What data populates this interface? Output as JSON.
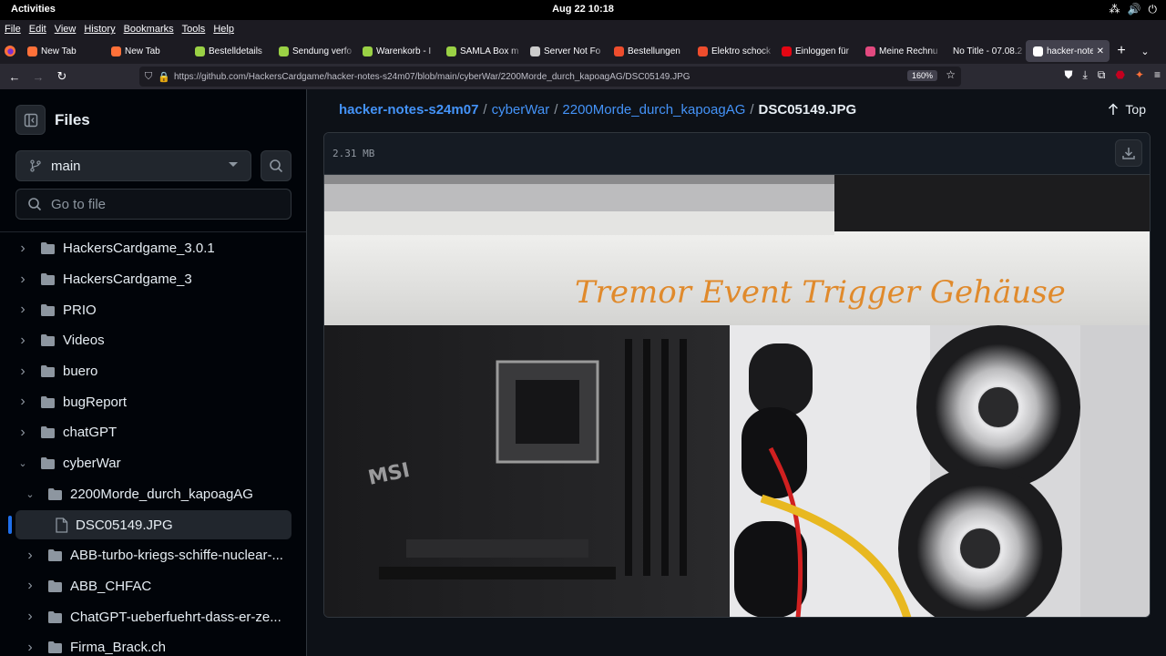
{
  "system": {
    "activities": "Activities",
    "clock": "Aug 22  10:18"
  },
  "menu": [
    "File",
    "Edit",
    "View",
    "History",
    "Bookmarks",
    "Tools",
    "Help"
  ],
  "tabs": [
    {
      "label": "New Tab",
      "color": "#ff7139"
    },
    {
      "label": "New Tab",
      "color": "#ff7139"
    },
    {
      "label": "Bestelldetails",
      "color": "#9ad145"
    },
    {
      "label": "Sendung verfo",
      "color": "#9ad145"
    },
    {
      "label": "Warenkorb - I",
      "color": "#9ad145"
    },
    {
      "label": "SAMLA Box m",
      "color": "#9ad145"
    },
    {
      "label": "Server Not Fo",
      "color": "#cccccc"
    },
    {
      "label": "Bestellungen",
      "color": "#ee4d2d"
    },
    {
      "label": "Elektro schock",
      "color": "#ee4d2d"
    },
    {
      "label": "Einloggen für",
      "color": "#e30613"
    },
    {
      "label": "Meine Rechnu",
      "color": "#e2497f"
    },
    {
      "label": "No Title - 07.08.2",
      "color": ""
    },
    {
      "label": "hacker-note",
      "color": "#ffffff"
    }
  ],
  "url": "https://github.com/HackersCardgame/hacker-notes-s24m07/blob/main/cyberWar/2200Morde_durch_kapoagAG/DSC05149.JPG",
  "zoom": "160%",
  "sidebar": {
    "title": "Files",
    "branch": "main",
    "goto_placeholder": "Go to file",
    "items": [
      {
        "label": "HackersCardgame_3.0.1",
        "indent": 0,
        "expanded": false,
        "type": "folder"
      },
      {
        "label": "HackersCardgame_3",
        "indent": 0,
        "expanded": false,
        "type": "folder"
      },
      {
        "label": "PRIO",
        "indent": 0,
        "expanded": false,
        "type": "folder"
      },
      {
        "label": "Videos",
        "indent": 0,
        "expanded": false,
        "type": "folder"
      },
      {
        "label": "buero",
        "indent": 0,
        "expanded": false,
        "type": "folder"
      },
      {
        "label": "bugReport",
        "indent": 0,
        "expanded": false,
        "type": "folder"
      },
      {
        "label": "chatGPT",
        "indent": 0,
        "expanded": false,
        "type": "folder"
      },
      {
        "label": "cyberWar",
        "indent": 0,
        "expanded": true,
        "type": "folder"
      },
      {
        "label": "2200Morde_durch_kapoagAG",
        "indent": 1,
        "expanded": true,
        "type": "folder"
      },
      {
        "label": "DSC05149.JPG",
        "indent": 2,
        "expanded": false,
        "type": "file",
        "selected": true
      },
      {
        "label": "ABB-turbo-kriegs-schiffe-nuclear-...",
        "indent": 1,
        "expanded": false,
        "type": "folder"
      },
      {
        "label": "ABB_CHFAC",
        "indent": 1,
        "expanded": false,
        "type": "folder"
      },
      {
        "label": "ChatGPT-ueberfuehrt-dass-er-ze...",
        "indent": 1,
        "expanded": false,
        "type": "folder"
      },
      {
        "label": "Firma_Brack.ch",
        "indent": 1,
        "expanded": false,
        "type": "folder"
      }
    ]
  },
  "breadcrumb": {
    "repo": "hacker-notes-s24m07",
    "dir1": "cyberWar",
    "dir2": "2200Morde_durch_kapoagAG",
    "file": "DSC05149.JPG",
    "top_label": "Top"
  },
  "file": {
    "size": "2.31 MB",
    "photo_text": "Tremor Event Trigger Gehäuse"
  }
}
